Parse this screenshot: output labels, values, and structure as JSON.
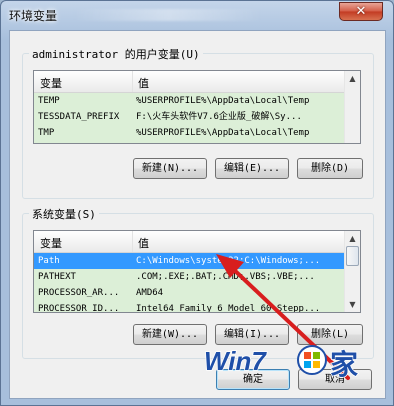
{
  "window": {
    "title": "环境变量",
    "close_glyph": "✕"
  },
  "user_vars": {
    "group_label": "administrator 的用户变量(U)",
    "columns": [
      "变量",
      "值"
    ],
    "rows": [
      {
        "name": "TEMP",
        "value": "%USERPROFILE%\\AppData\\Local\\Temp"
      },
      {
        "name": "TESSDATA_PREFIX",
        "value": "F:\\火车头软件V7.6企业版_破解\\Sy..."
      },
      {
        "name": "TMP",
        "value": "%USERPROFILE%\\AppData\\Local\\Temp"
      }
    ],
    "buttons": {
      "new": "新建(N)...",
      "edit": "编辑(E)...",
      "delete": "删除(D)"
    }
  },
  "system_vars": {
    "group_label": "系统变量(S)",
    "columns": [
      "变量",
      "值"
    ],
    "rows": [
      {
        "name": "Path",
        "value": "C:\\Windows\\system32;C:\\Windows;...",
        "selected": true
      },
      {
        "name": "PATHEXT",
        "value": ".COM;.EXE;.BAT;.CMD;.VBS;.VBE;..."
      },
      {
        "name": "PROCESSOR_AR...",
        "value": "AMD64"
      },
      {
        "name": "PROCESSOR_ID...",
        "value": "Intel64 Family 6 Model 60 Stepp..."
      }
    ],
    "buttons": {
      "new": "新建(W)...",
      "edit": "编辑(I)...",
      "delete": "删除(L)"
    }
  },
  "dialog_buttons": {
    "ok": "确定",
    "cancel": "取消"
  },
  "watermark": {
    "text": "Win7zhijia.cn",
    "brand_color": "#1f4fa8"
  },
  "colors": {
    "selection": "#3399ff",
    "list_bg": "#dcefd7",
    "arrow": "#d81e1e"
  }
}
